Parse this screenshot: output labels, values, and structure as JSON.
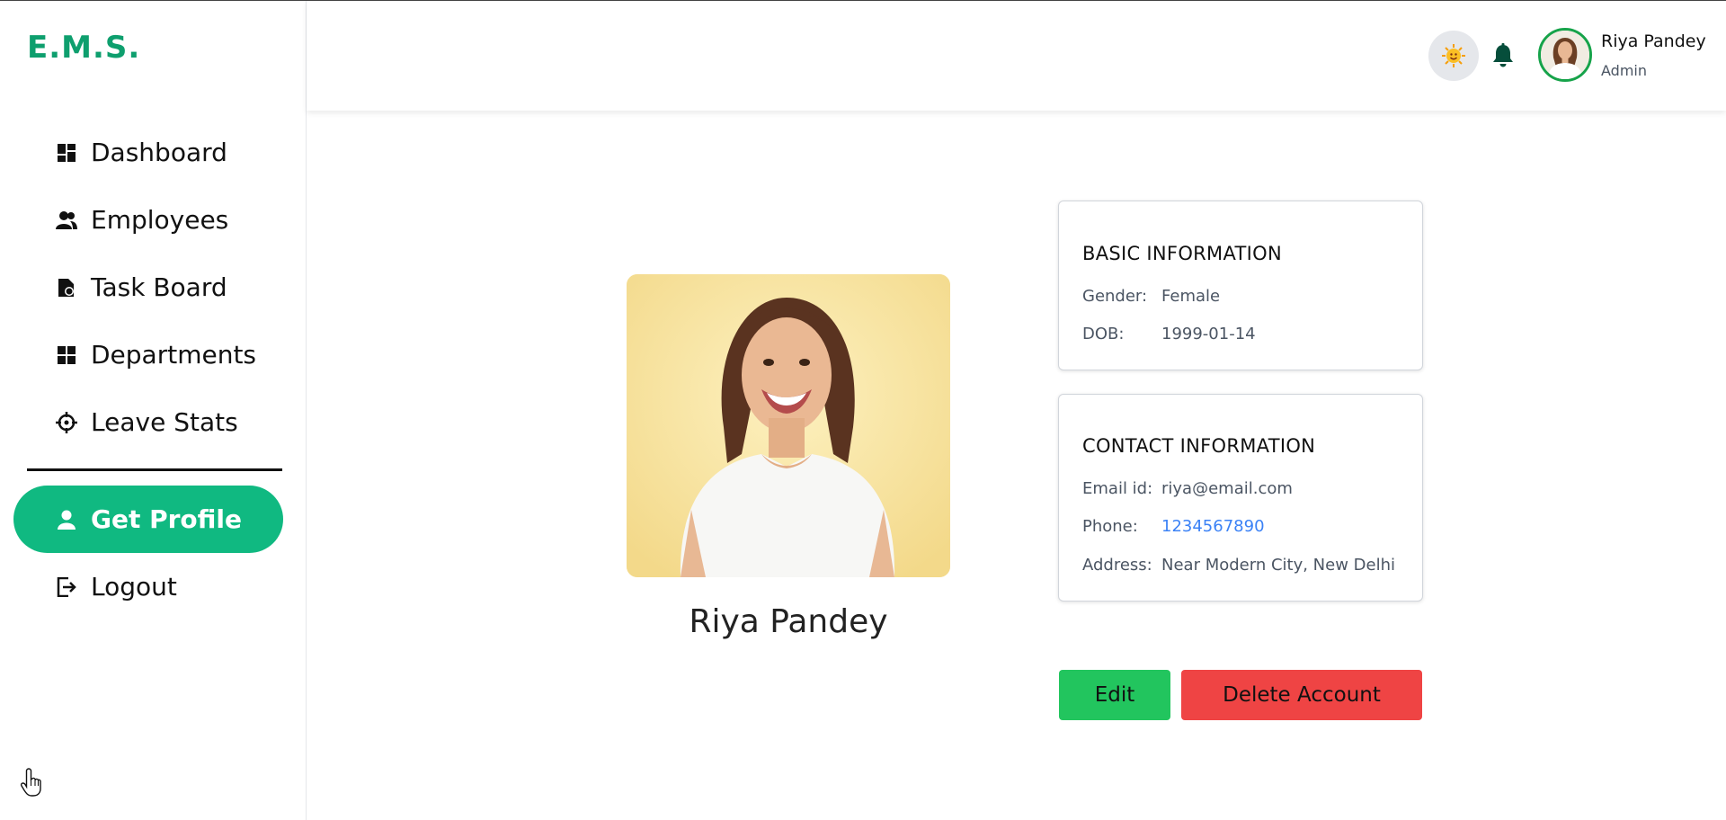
{
  "sidebar": {
    "logo": "E.M.S.",
    "items": [
      {
        "label": "Dashboard",
        "icon": "dashboard-icon"
      },
      {
        "label": "Employees",
        "icon": "employees-icon"
      },
      {
        "label": "Task Board",
        "icon": "task-board-icon"
      },
      {
        "label": "Departments",
        "icon": "departments-icon"
      },
      {
        "label": "Leave Stats",
        "icon": "crosshair-icon"
      },
      {
        "label": "Get Profile",
        "icon": "user-icon",
        "active": true
      },
      {
        "label": "Logout",
        "icon": "logout-icon"
      }
    ]
  },
  "header": {
    "user_name": "Riya Pandey",
    "user_role": "Admin",
    "icons": [
      "theme-toggle-icon",
      "bell-icon"
    ]
  },
  "profile": {
    "name": "Riya Pandey"
  },
  "basic_info": {
    "title": "BASIC INFORMATION",
    "gender_label": "Gender:",
    "gender": "Female",
    "dob_label": "DOB:",
    "dob": "1999-01-14"
  },
  "contact_info": {
    "title": "CONTACT INFORMATION",
    "email_label": "Email id:",
    "email": "riya@email.com",
    "phone_label": "Phone:",
    "phone": "1234567890",
    "address_label": "Address:",
    "address": "Near Modern City, New Delhi"
  },
  "actions": {
    "edit_label": "Edit",
    "delete_label": "Delete Account"
  },
  "colors": {
    "brand": "#0e9f6e",
    "active_nav": "#10b981",
    "edit_button": "#22c55e",
    "delete_button": "#ef4444",
    "link": "#3b82f6"
  }
}
